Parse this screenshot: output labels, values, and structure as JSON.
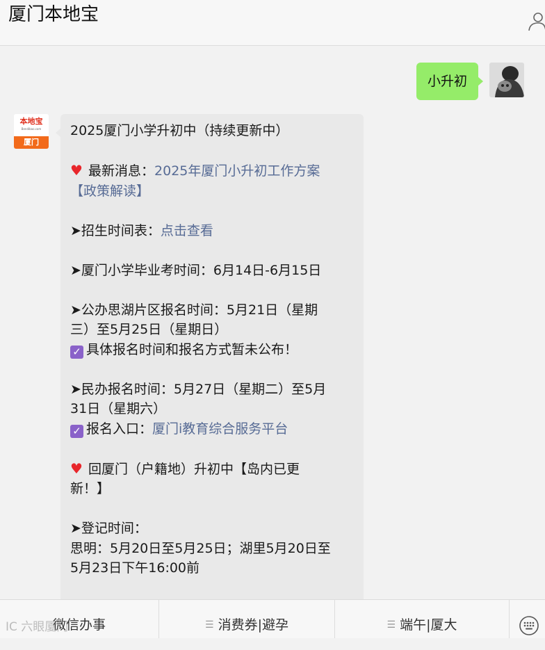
{
  "header": {
    "title": "厦门本地宝",
    "profile_icon": "person-icon"
  },
  "outgoing": {
    "text": "小升初",
    "bubble_color": "#95ec69"
  },
  "brand_avatar": {
    "top_text": "本地宝",
    "sub_text": "Bendibao.com",
    "bottom_text": "厦门"
  },
  "message": {
    "title": "2025厦门小学升初中（持续更新中）",
    "news_label": "最新消息：",
    "news_link": "2025年厦门小升初工作方案",
    "news_link_2": "【政策解读】",
    "schedule_label": "➤招生时间表：",
    "schedule_link": "点击查看",
    "exam_time": "➤厦门小学毕业考时间：6月14日-6月15日",
    "public_1": "➤公办思湖片区报名时间：5月21日（星期",
    "public_2": "三）至5月25日（星期日）",
    "public_note": "具体报名时间和报名方式暂未公布！",
    "private_1": "➤民办报名时间：5月27日（星期二）至5月",
    "private_2": "31日（星期六）",
    "entry_label": "报名入口：",
    "entry_link": "厦门i教育综合服务平台",
    "return_1": "回厦门（户籍地）升初中【岛内已更",
    "return_2": "新！】",
    "register_label": "➤登记时间：",
    "register_1": "思明：5月20日至5月25日；湖里5月20日至",
    "register_2": "5月23日下午16:00前",
    "link_color": "#576b95",
    "heart_color": "#e8262b",
    "check_color": "#8a62c9"
  },
  "menu": {
    "items": [
      "微信办事",
      "消费券|避孕",
      "端午|厦大"
    ],
    "keyboard_icon": "keyboard-icon"
  },
  "watermark": "IC 六眼厦门"
}
